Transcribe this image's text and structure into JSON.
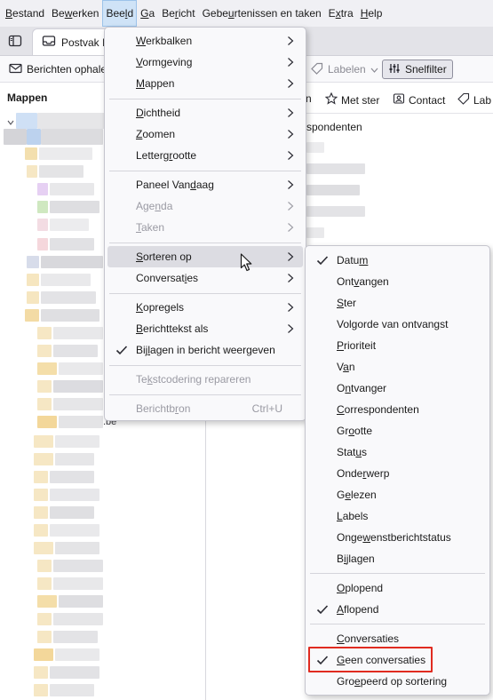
{
  "menubar": {
    "items": [
      {
        "pre": "",
        "u": "B",
        "post": "estand"
      },
      {
        "pre": "Be",
        "u": "w",
        "post": "erken"
      },
      {
        "pre": "Bee",
        "u": "l",
        "post": "d"
      },
      {
        "pre": "",
        "u": "G",
        "post": "a"
      },
      {
        "pre": "Be",
        "u": "r",
        "post": "icht"
      },
      {
        "pre": "Gebe",
        "u": "u",
        "post": "rtenissen en taken"
      },
      {
        "pre": "E",
        "u": "x",
        "post": "tra"
      },
      {
        "pre": "",
        "u": "H",
        "post": "elp"
      }
    ]
  },
  "tab": {
    "label": "Postvak I"
  },
  "toolbar": {
    "get_messages": "Berichten ophale",
    "labels": "Labelen",
    "quick_filter": "Snelfilter"
  },
  "folders": {
    "header": "Mappen",
    "partial_text": ".be"
  },
  "filterbar": {
    "partial": "n",
    "starred": "Met ster",
    "contact": "Contact",
    "labels": "Lab"
  },
  "message_list": {
    "header_partial": "spondenten"
  },
  "view_menu": {
    "items": [
      {
        "pre": "",
        "u": "W",
        "post": "erkbalken"
      },
      {
        "pre": "",
        "u": "V",
        "post": "ormgeving"
      },
      {
        "pre": "",
        "u": "M",
        "post": "appen"
      },
      {
        "pre": "",
        "u": "D",
        "post": "ichtheid"
      },
      {
        "pre": "",
        "u": "Z",
        "post": "oomen"
      },
      {
        "pre": "Letterg",
        "u": "r",
        "post": "ootte"
      },
      {
        "pre": "Paneel Van",
        "u": "d",
        "post": "aag"
      },
      {
        "pre": "Age",
        "u": "n",
        "post": "da"
      },
      {
        "pre": "",
        "u": "T",
        "post": "aken"
      },
      {
        "pre": "",
        "u": "S",
        "post": "orteren op"
      },
      {
        "pre": "Conversat",
        "u": "i",
        "post": "es"
      },
      {
        "pre": "",
        "u": "K",
        "post": "opregels"
      },
      {
        "pre": "",
        "u": "B",
        "post": "erichttekst als"
      },
      {
        "pre": "Bij",
        "u": "l",
        "post": "agen in bericht weergeven"
      },
      {
        "pre": "Te",
        "u": "k",
        "post": "stcodering repareren"
      },
      {
        "pre": "Berichtb",
        "u": "r",
        "post": "on"
      }
    ],
    "shortcut": "Ctrl+U"
  },
  "sort_menu": {
    "items": [
      {
        "pre": "Datu",
        "u": "m",
        "post": ""
      },
      {
        "pre": "Ont",
        "u": "v",
        "post": "angen"
      },
      {
        "pre": "",
        "u": "S",
        "post": "ter"
      },
      {
        "pre": "Volgorde van ontvan",
        "u": "g",
        "post": "st"
      },
      {
        "pre": "",
        "u": "P",
        "post": "rioriteit"
      },
      {
        "pre": "V",
        "u": "a",
        "post": "n"
      },
      {
        "pre": "O",
        "u": "n",
        "post": "tvanger"
      },
      {
        "pre": "",
        "u": "C",
        "post": "orrespondenten"
      },
      {
        "pre": "Gr",
        "u": "o",
        "post": "otte"
      },
      {
        "pre": "Stat",
        "u": "u",
        "post": "s"
      },
      {
        "pre": "Onde",
        "u": "r",
        "post": "werp"
      },
      {
        "pre": "G",
        "u": "e",
        "post": "lezen"
      },
      {
        "pre": "",
        "u": "L",
        "post": "abels"
      },
      {
        "pre": "Onge",
        "u": "w",
        "post": "enstberichtstatus"
      },
      {
        "pre": "B",
        "u": "i",
        "post": "jlagen"
      },
      {
        "pre": "",
        "u": "O",
        "post": "plopend"
      },
      {
        "pre": "",
        "u": "A",
        "post": "flopend"
      },
      {
        "pre": "",
        "u": "C",
        "post": "onversaties"
      },
      {
        "pre": "",
        "u": "G",
        "post": "een conversaties"
      },
      {
        "pre": "Gro",
        "u": "e",
        "post": "peerd op sortering"
      }
    ]
  },
  "colors": {
    "highlight": "#e02b20",
    "menu_hover": "#dcdce2",
    "menubar_active": "#cfe3f7"
  }
}
